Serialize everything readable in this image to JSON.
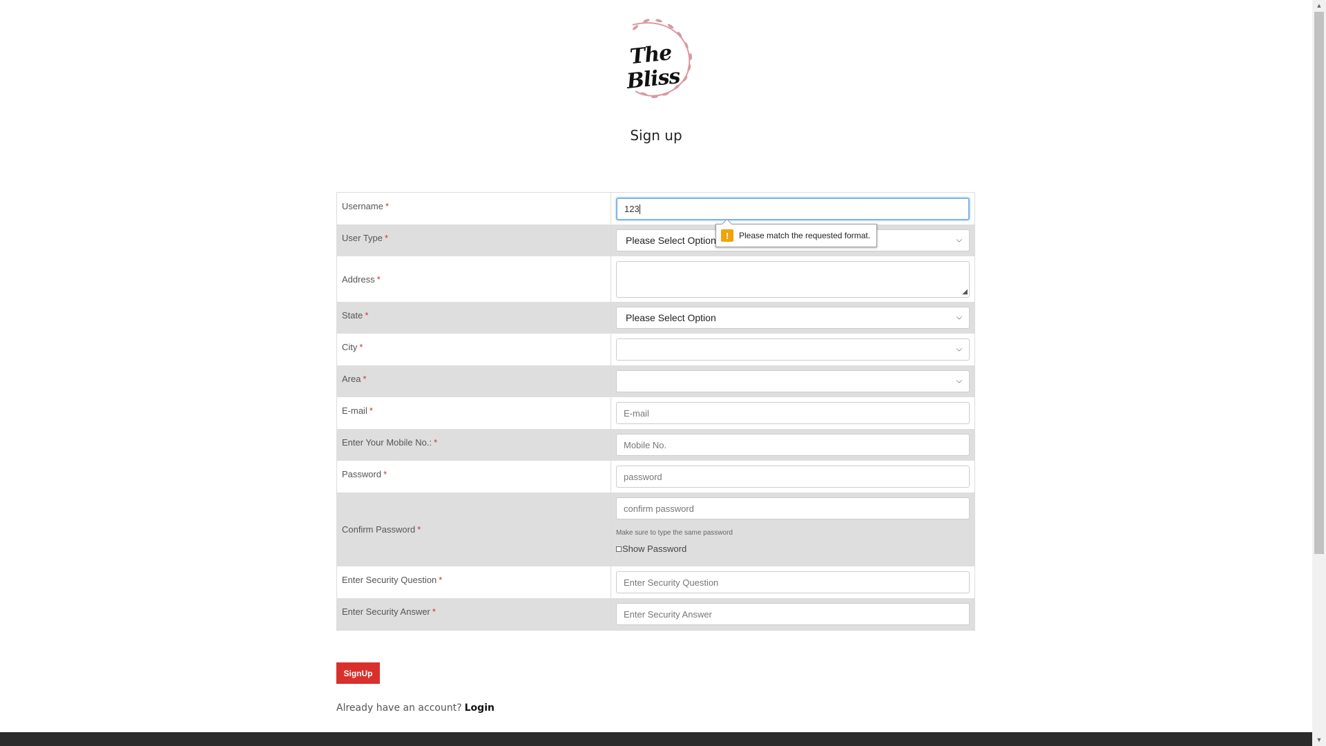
{
  "logo": {
    "text": "The Bliss"
  },
  "title": "Sign up",
  "tooltip": {
    "message": "Please match the requested format."
  },
  "form": {
    "username": {
      "label": "Username",
      "value": "123"
    },
    "user_type": {
      "label": "User Type",
      "selected": "Please Select Option"
    },
    "address": {
      "label": "Address"
    },
    "state": {
      "label": "State",
      "selected": "Please Select Option"
    },
    "city": {
      "label": "City",
      "selected": ""
    },
    "area": {
      "label": "Area",
      "selected": ""
    },
    "email": {
      "label": "E-mail",
      "placeholder": "E-mail"
    },
    "mobile": {
      "label": "Enter Your Mobile No.:",
      "placeholder": "Mobile No."
    },
    "password": {
      "label": "Password",
      "placeholder": "password"
    },
    "confirm_password": {
      "label": "Confirm Password",
      "placeholder": "confirm password",
      "hint": "Make sure to type the same password",
      "show_password_label": "Show Password"
    },
    "security_question": {
      "label": "Enter Security Question",
      "placeholder": "Enter Security Question"
    },
    "security_answer": {
      "label": "Enter Security Answer",
      "placeholder": "Enter Security Answer"
    },
    "required_mark": "*"
  },
  "signup_button": "SignUp",
  "login_prompt": {
    "text": "Already have an account?",
    "link": "Login"
  },
  "colors": {
    "accent": "#d9302c",
    "alt_row": "#dedede",
    "focus": "#7fb3e8",
    "warning": "#f0a30a"
  }
}
